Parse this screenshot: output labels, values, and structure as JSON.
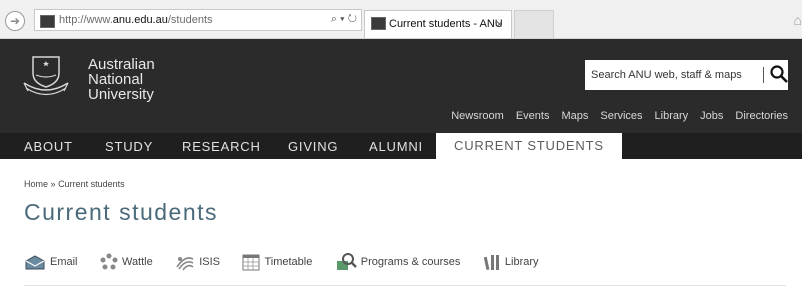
{
  "browser": {
    "url_prefix": "http://www.",
    "url_domain": "anu.edu.au",
    "url_path": "/students",
    "addr_icons": "⌕ ▾ ↻",
    "tab_title": "Current students - ANU",
    "tab_close": "×"
  },
  "header": {
    "logo_lines": [
      "Australian",
      "National",
      "University"
    ],
    "search_placeholder": "Search ANU web, staff & maps",
    "utility_links": [
      "Newsroom",
      "Events",
      "Maps",
      "Services",
      "Library",
      "Jobs",
      "Directories"
    ]
  },
  "mainnav": {
    "items": [
      "ABOUT",
      "STUDY",
      "RESEARCH",
      "GIVING",
      "ALUMNI",
      "CURRENT STUDENTS"
    ],
    "active": "CURRENT STUDENTS"
  },
  "breadcrumb": {
    "home": "Home",
    "sep": "»",
    "current": "Current students"
  },
  "page_title": "Current students",
  "quick_links": [
    {
      "label": "Email",
      "icon": "email-icon"
    },
    {
      "label": "Wattle",
      "icon": "wattle-icon"
    },
    {
      "label": "ISIS",
      "icon": "isis-icon"
    },
    {
      "label": "Timetable",
      "icon": "timetable-icon"
    },
    {
      "label": "Programs & courses",
      "icon": "programs-icon"
    },
    {
      "label": "Library",
      "icon": "library-icon"
    }
  ],
  "colors": {
    "header_bg": "#2b2b2b",
    "nav_bg": "#1f1f1f",
    "title": "#4a6a7a"
  }
}
